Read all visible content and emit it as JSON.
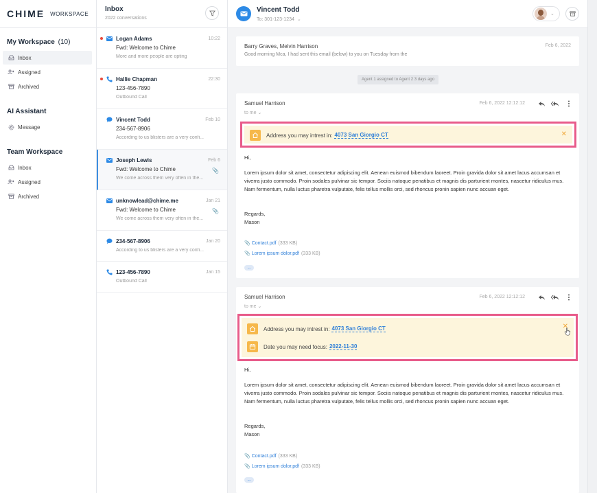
{
  "brand": {
    "logo": "CHIME",
    "workspace": "WORKSPACE"
  },
  "sidebar": {
    "my_workspace": {
      "title": "My Workspace",
      "count": "(10)",
      "items": [
        {
          "label": "Inbox"
        },
        {
          "label": "Assigned"
        },
        {
          "label": "Archived"
        }
      ]
    },
    "ai_assistant": {
      "title": "AI Assistant",
      "items": [
        {
          "label": "Message"
        }
      ]
    },
    "team_workspace": {
      "title": "Team Workspace",
      "items": [
        {
          "label": "Inbox"
        },
        {
          "label": "Assigned"
        },
        {
          "label": "Archived"
        }
      ]
    }
  },
  "inbox": {
    "title": "Inbox",
    "subtitle": "2022 conversations",
    "conversations": [
      {
        "channel": "email",
        "unread": true,
        "name": "Logan Adams",
        "date": "10:22",
        "subject": "Fwd: Welcome to Chime",
        "preview": "More and more people are opting"
      },
      {
        "channel": "call",
        "unread": true,
        "name": "Hallie Chapman",
        "date": "22:30",
        "subject": "123-456-7890",
        "preview": "Outbound Call"
      },
      {
        "channel": "sms",
        "unread": false,
        "name": "Vincent Todd",
        "date": "Feb 10",
        "subject": "234-567-8906",
        "preview": "According to us blisters are a very confi..."
      },
      {
        "channel": "email",
        "unread": false,
        "name": "Joseph Lewis",
        "date": "Feb 6",
        "subject": "Fwd: Welcome to Chime",
        "preview": "We come across them very often in the..."
      },
      {
        "channel": "email",
        "unread": false,
        "name": "unknowlead@chime.me",
        "date": "Jan 21",
        "subject": "Fwd: Welcome to Chime",
        "preview": "We come across them very often in the..."
      },
      {
        "channel": "sms",
        "unread": false,
        "name": "234-567-8906",
        "date": "Jan 20",
        "subject": "",
        "preview": "According to us blisters are a very confi..."
      },
      {
        "channel": "call",
        "unread": false,
        "name": "123-456-7890",
        "date": "Jan 15",
        "subject": "",
        "preview": "Outbound Call"
      }
    ]
  },
  "contact": {
    "name": "Vincent Todd",
    "to": "To: 301-123-1234"
  },
  "thread": {
    "summary": {
      "names": "Barry Graves, Melvin Harrison",
      "date": "Feb 6, 2022",
      "snippet": "Good morning Mca, I had sent this email (below) to you on Tuesday from the"
    },
    "assignment": "Agent 1 assigned to Agent 2  3 days ago",
    "messages": [
      {
        "from": "Samuel Harrison",
        "to": "to me",
        "timestamp": "Feb 6, 2022 12:12:12",
        "insights": [
          {
            "label": "Address you may intrest in:",
            "value": "4073 San Giorgio CT"
          }
        ],
        "greeting": "Hi,",
        "body": "Lorem ipsum dolor sit amet, consectetur adipiscing elit. Aenean euismod bibendum laoreet. Proin gravida dolor sit amet lacus accumsan et viverra justo commodo. Proin sodales pulvinar sic tempor. Sociis natoque penatibus et magnis dis parturient montes, nascetur ridiculus mus. Nam fermentum, nulla luctus pharetra vulputate, felis tellus mollis orci, sed rhoncus pronin sapien nunc accuan eget.",
        "regards": "Regards,",
        "signature": "Mason",
        "attachments": [
          {
            "name": "Contact.pdf",
            "size": "(333 KB)"
          },
          {
            "name": "Lorem ipsum dolor.pdf",
            "size": "(333 KB)"
          }
        ],
        "more": "..."
      },
      {
        "from": "Samuel Harrison",
        "to": "to me",
        "timestamp": "Feb 6, 2022 12:12:12",
        "insights": [
          {
            "label": "Address you may intrest in:",
            "value": "4073 San Giorgio CT"
          },
          {
            "label": "Date you may need focus:",
            "value": "2022-11-30"
          }
        ],
        "greeting": "Hi,",
        "body": "Lorem ipsum dolor sit amet, consectetur adipiscing elit. Aenean euismod bibendum laoreet. Proin gravida dolor sit amet lacus accumsan et viverra justo commodo. Proin sodales pulvinar sic tempor. Sociis natoque penatibus et magnis dis parturient montes, nascetur ridiculus mus. Nam fermentum, nulla luctus pharetra vulputate, felis tellus mollis orci, sed rhoncus pronin sapien nunc accuan eget.",
        "regards": "Regards,",
        "signature": "Mason",
        "attachments": [
          {
            "name": "Contact.pdf",
            "size": "(333 KB)"
          },
          {
            "name": "Lorem ipsum dolor.pdf",
            "size": "(333 KB)"
          }
        ],
        "more": "..."
      }
    ]
  },
  "colors": {
    "accent": "#2d8ae6",
    "highlight_border": "#e85b8a",
    "insight_bg": "#fdf5dc",
    "insight_icon": "#f6b84a",
    "unread_dot": "#e84a3a"
  }
}
